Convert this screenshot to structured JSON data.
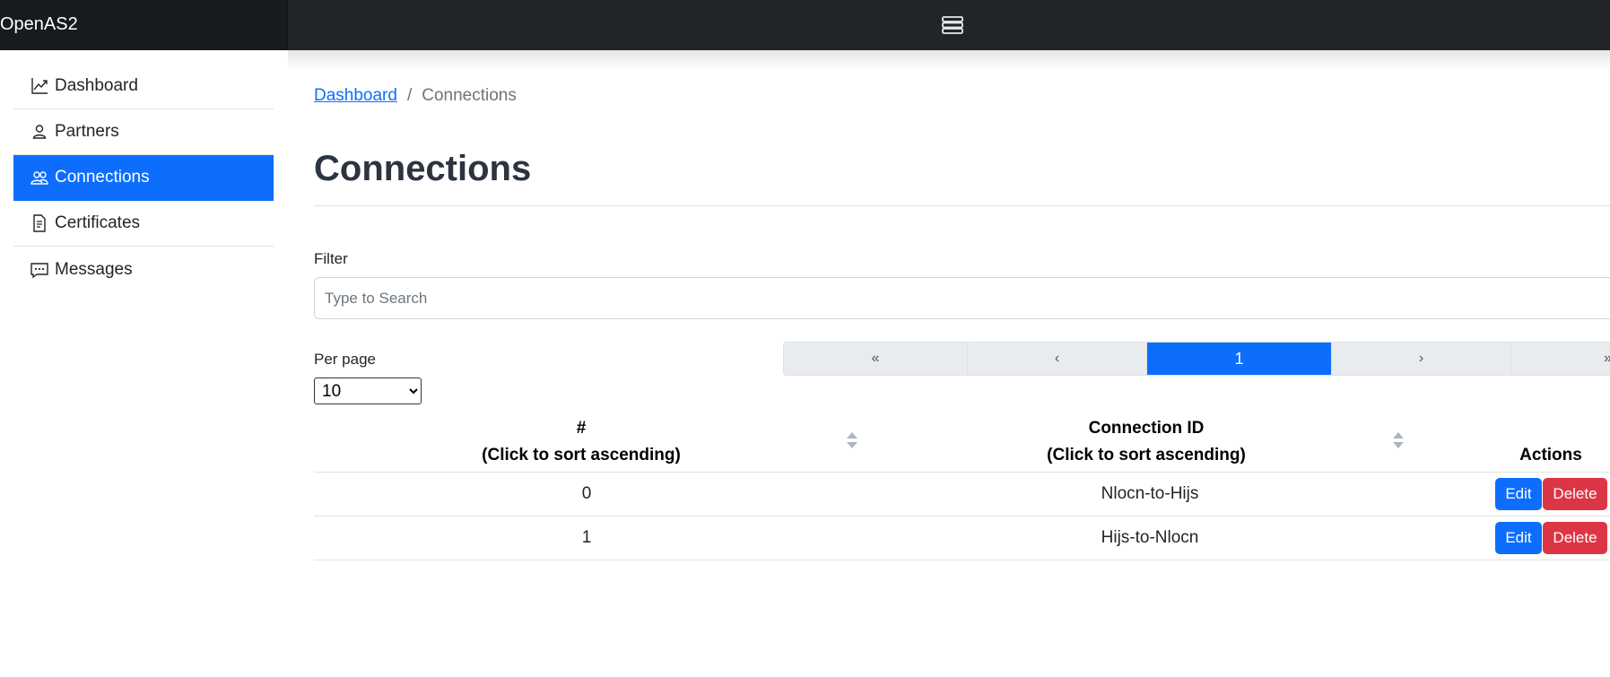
{
  "app": {
    "brand": "OpenAS2",
    "toggler_icon": "navbar-toggler-icon"
  },
  "sidebar": {
    "items": [
      {
        "label": "Dashboard",
        "icon": "graph-up-icon",
        "active": false
      },
      {
        "label": "Partners",
        "icon": "person-icon",
        "active": false
      },
      {
        "label": "Connections",
        "icon": "people-icon",
        "active": true
      },
      {
        "label": "Certificates",
        "icon": "file-text-icon",
        "active": false
      },
      {
        "label": "Messages",
        "icon": "chat-dots-icon",
        "active": false
      }
    ]
  },
  "breadcrumb": {
    "home": "Dashboard",
    "separator": "/",
    "current": "Connections"
  },
  "page": {
    "title": "Connections"
  },
  "filter": {
    "label": "Filter",
    "placeholder": "Type to Search",
    "value": ""
  },
  "per_page": {
    "label": "Per page",
    "selected": "10"
  },
  "pagination": {
    "first": "«",
    "prev": "‹",
    "current": "1",
    "next": "›",
    "last": "»"
  },
  "table": {
    "headers": [
      {
        "line1": "#",
        "line2": "(Click to sort ascending)",
        "sortable": true
      },
      {
        "line1": "Connection ID",
        "line2": "(Click to sort ascending)",
        "sortable": true
      },
      {
        "line1": "",
        "line2": "Actions",
        "sortable": false
      }
    ],
    "rows": [
      {
        "index": "0",
        "connection_id": "Nlocn-to-Hijs"
      },
      {
        "index": "1",
        "connection_id": "Hijs-to-Nlocn"
      }
    ],
    "actions": {
      "edit": "Edit",
      "delete": "Delete"
    }
  },
  "colors": {
    "primary": "#0d6efd",
    "danger": "#dc3545",
    "navbar": "#212529"
  }
}
